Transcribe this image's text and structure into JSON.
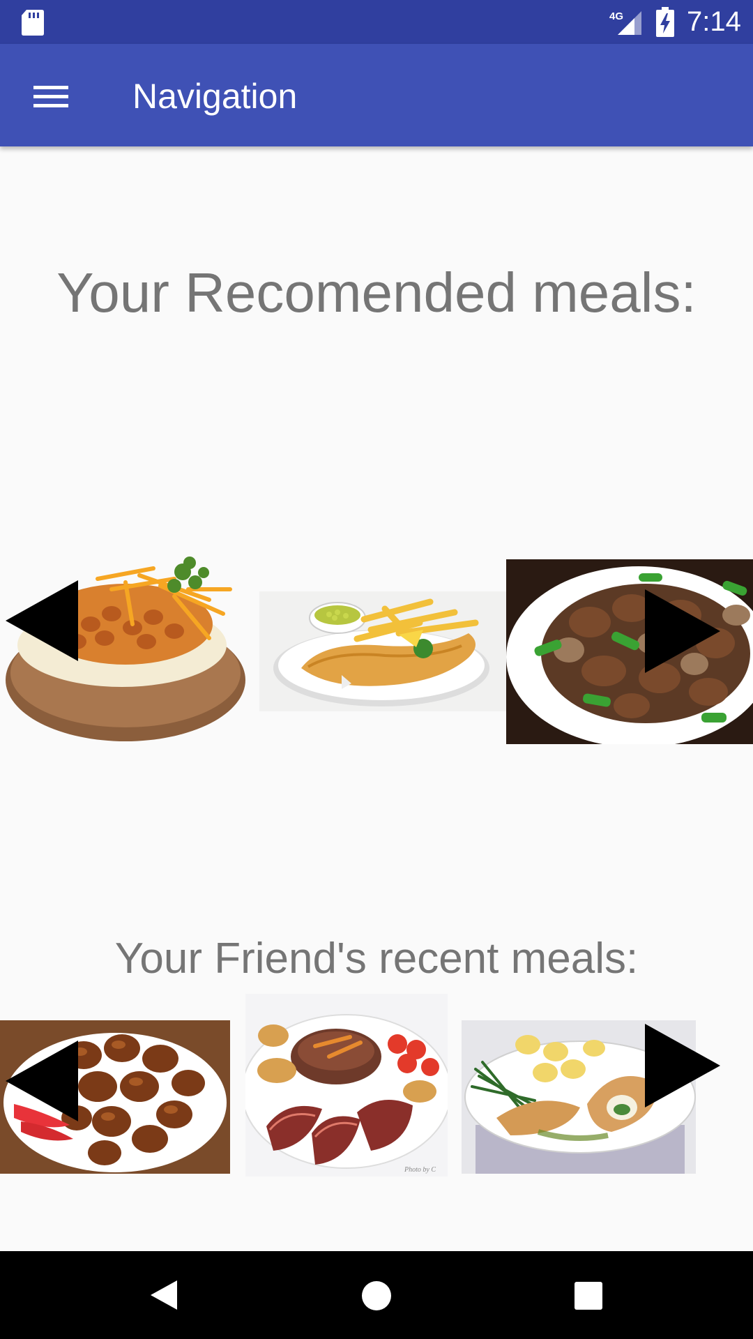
{
  "status_bar": {
    "network": "4G",
    "time": "7:14",
    "icons": [
      "sd-card-icon",
      "signal-icon",
      "battery-charging-icon"
    ]
  },
  "app_bar": {
    "title": "Navigation",
    "menu_icon": "hamburger-menu-icon",
    "background": "#3f51b5",
    "status_background": "#303f9f"
  },
  "recommended": {
    "heading": "Your Recomended meals:",
    "meals": [
      "baked-potato-with-beans-and-cheese",
      "fish-and-chips-with-peas",
      "beef-with-peppers-and-mushrooms"
    ],
    "prev_icon": "arrow-left-icon",
    "next_icon": "arrow-right-icon"
  },
  "friends": {
    "heading": "Your Friend's recent meals:",
    "meals": [
      "glazed-chicken-bites",
      "sliced-duck-with-roast-vegetables",
      "chicken-kiev-with-green-beans"
    ],
    "prev_icon": "arrow-left-icon",
    "next_icon": "arrow-right-icon",
    "photo_credit": "Photo by C"
  },
  "nav_bar": {
    "icons": [
      "back-icon",
      "home-icon",
      "recents-icon"
    ]
  }
}
